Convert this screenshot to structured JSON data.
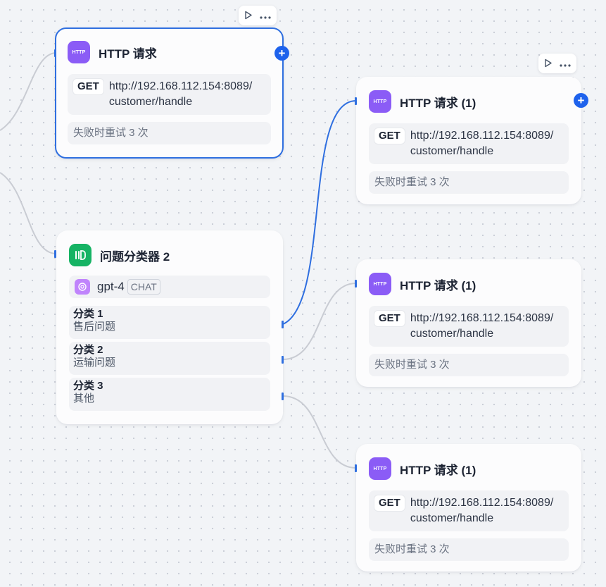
{
  "nodes": {
    "http_top": {
      "title": "HTTP 请求",
      "icon_label": "HTTP",
      "method": "GET",
      "url_line1": "http://192.168.112.154:8089/",
      "url_line2": "customer/handle",
      "retry": "失败时重试 3 次"
    },
    "classifier": {
      "title": "问题分类器 2",
      "model": "gpt-4",
      "model_badge": "CHAT",
      "classes": [
        {
          "name": "分类 1",
          "desc": "售后问题"
        },
        {
          "name": "分类 2",
          "desc": "运输问题"
        },
        {
          "name": "分类 3",
          "desc": "其他"
        }
      ]
    },
    "http_1": {
      "title": "HTTP 请求 (1)",
      "icon_label": "HTTP",
      "method": "GET",
      "url_line1": "http://192.168.112.154:8089/",
      "url_line2": "customer/handle",
      "retry": "失败时重试 3 次"
    },
    "http_2": {
      "title": "HTTP 请求 (1)",
      "icon_label": "HTTP",
      "method": "GET",
      "url_line1": "http://192.168.112.154:8089/",
      "url_line2": "customer/handle",
      "retry": "失败时重试 3 次"
    },
    "http_3": {
      "title": "HTTP 请求 (1)",
      "icon_label": "HTTP",
      "method": "GET",
      "url_line1": "http://192.168.112.154:8089/",
      "url_line2": "customer/handle",
      "retry": "失败时重试 3 次"
    }
  },
  "toolbar": {
    "run_icon": "play-icon",
    "more_icon": "more-icon",
    "add_icon": "plus-icon"
  },
  "colors": {
    "accent": "#2f6fe0",
    "http_icon": "#8b5cf6",
    "classifier_icon": "#16b364",
    "add_button": "#1e62ec"
  }
}
